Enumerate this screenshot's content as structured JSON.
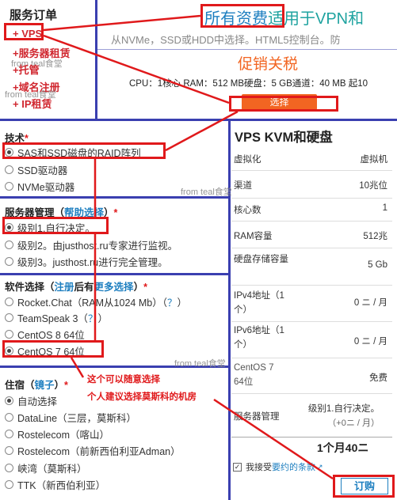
{
  "sidebar": {
    "title": "服务订单",
    "items": [
      {
        "label": "+ VPS"
      },
      {
        "label": "+服务器租赁"
      },
      {
        "label": "+托管"
      },
      {
        "label": "+域名注册"
      },
      {
        "label": "+ IP租赁"
      }
    ]
  },
  "watermark": "from teal食堂",
  "header": {
    "title_part1": "所有资费",
    "title_part2": "适用于VPN和",
    "subtitle": "从NVMe，SSD或HDD中选择。HTML5控制台。防"
  },
  "promo": {
    "title": "促销关税",
    "specs": "CPU：1核心 RAM：512 MB硬盘：5 GB通道：40 MB 起10",
    "select_label": "选择"
  },
  "tech": {
    "title": "技术",
    "required": "*",
    "options": [
      {
        "label": "SAS和SSD磁盘的RAID阵列",
        "checked": true
      },
      {
        "label": "SSD驱动器",
        "checked": false
      },
      {
        "label": "NVMe驱动器",
        "checked": false
      }
    ]
  },
  "management": {
    "title": "服务器管理（",
    "help_link": "帮助选择",
    "title_end": "）",
    "required": "*",
    "options": [
      {
        "label": "级别1.自行决定。",
        "checked": true
      },
      {
        "label": "级别2。由justhost.ru专家进行监视。",
        "checked": false
      },
      {
        "label": "级别3。justhost.ru进行完全管理。",
        "checked": false
      }
    ]
  },
  "software": {
    "title": "软件选择（",
    "reg_link": "注册",
    "title_mid": "后有",
    "more_link": "更多选择",
    "title_end": "）",
    "required": "*",
    "options": [
      {
        "label": "Rocket.Chat（RAM从1024 Mb）（",
        "help": "？",
        "tail": "）",
        "checked": false
      },
      {
        "label": "TeamSpeak 3（",
        "help": "？",
        "tail": "）",
        "checked": false
      },
      {
        "label": "CentOS 8 64位",
        "help": "",
        "tail": "",
        "checked": false
      },
      {
        "label": "CentOS 7 64位",
        "help": "",
        "tail": "",
        "checked": true
      }
    ]
  },
  "location": {
    "title": "住宿（",
    "mirror_link": "镜子",
    "title_end": "）",
    "required": "*",
    "options": [
      {
        "label": "自动选择",
        "checked": true
      },
      {
        "label": "DataLine（三层，莫斯科）",
        "checked": false
      },
      {
        "label": "Rostelecom（喀山）",
        "checked": false
      },
      {
        "label": "Rostelecom（前新西伯利亚Adman）",
        "checked": false
      },
      {
        "label": "峡湾（莫斯科）",
        "checked": false
      },
      {
        "label": "TTK（新西伯利亚）",
        "checked": false
      }
    ]
  },
  "annotations": {
    "note1": "这个可以随意选择",
    "note2": "个人建议选择莫斯科的机房"
  },
  "spec_panel": {
    "title": "VPS KVM和硬盘",
    "rows": [
      {
        "key": "虚拟化",
        "value": "虚拟机"
      },
      {
        "key": "渠道",
        "value": "10兆位"
      },
      {
        "key": "核心数",
        "value": "1"
      },
      {
        "key": "RAM容量",
        "value": "512兆"
      },
      {
        "key": "硬盘存储容量",
        "value": "5 Gb"
      },
      {
        "key": "IPv4地址（1个）",
        "value": "0 ニ / 月"
      },
      {
        "key": "IPv6地址（1个）",
        "value": "0 ニ / 月"
      },
      {
        "key": "CentOS 7 64位",
        "value": "免费"
      },
      {
        "key": "服务器管理",
        "value": "级别1.自行决定。",
        "extra": "（+0ニ / 月）"
      }
    ],
    "total": "1个月40ニ",
    "agree_text": "我接受",
    "agree_link": "要约的条款",
    "order_label": "订购",
    "accent": "#e0191b",
    "frame_color": "#3a3fb0",
    "button_color": "#f26522"
  }
}
